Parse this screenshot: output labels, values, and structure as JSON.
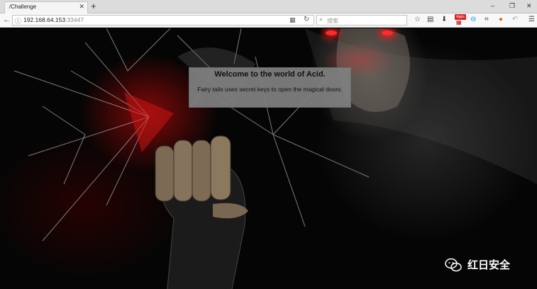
{
  "browser": {
    "tab_title": "/Challenge",
    "tab_close": "✕",
    "new_tab": "+",
    "window_controls": {
      "minimize": "–",
      "maximize": "❐",
      "close": "✕"
    },
    "url_host": "192.168.64.153",
    "url_port": ":33447",
    "search_placeholder": "搜索",
    "apps_badge": "Apps"
  },
  "page": {
    "welcome_title": "Welcome to the world of Acid.",
    "welcome_text": "Fairy tails uses secret keys to open the magical doors."
  },
  "watermark": {
    "text": "红日安全"
  }
}
